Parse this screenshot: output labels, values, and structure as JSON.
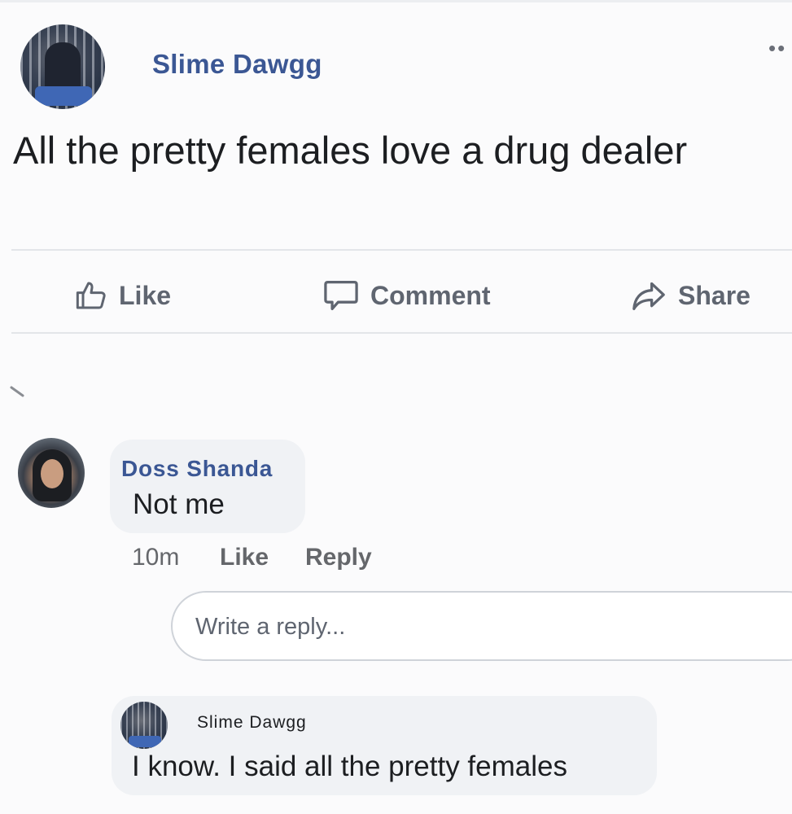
{
  "post": {
    "author": "Slime Dawgg",
    "more_menu": "••",
    "text": "All the pretty females love a drug dealer"
  },
  "actions": {
    "like": "Like",
    "comment": "Comment",
    "share": "Share"
  },
  "comment": {
    "author": "Doss Shanda",
    "text": "Not me",
    "time": "10m",
    "like": "Like",
    "reply": "Reply"
  },
  "reply_input": {
    "placeholder": "Write a reply..."
  },
  "reply": {
    "author": "Slime Dawgg",
    "text": "I know. I said all the pretty females"
  },
  "colors": {
    "author_link": "#3b5794",
    "action_text": "#5f6570",
    "bubble": "#f0f2f5"
  }
}
